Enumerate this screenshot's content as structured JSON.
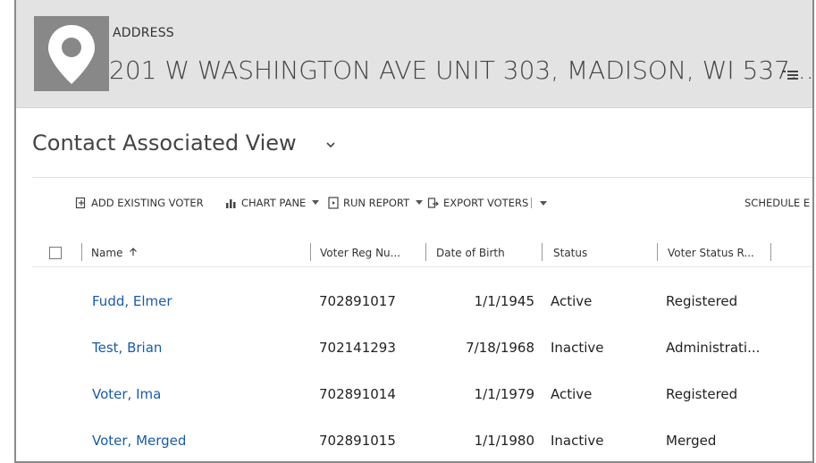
{
  "header": {
    "eyebrow": "ADDRESS",
    "title": "201 W WASHINGTON AVE UNIT 303, MADISON, WI 537...",
    "avatar_icon": "map-pin-icon",
    "menu_icon": "list-menu-icon"
  },
  "view": {
    "title": "Contact Associated View",
    "chevron_icon": "chevron-down-icon"
  },
  "commands": {
    "add_existing": "ADD EXISTING VOTER",
    "chart_pane": "CHART PANE",
    "run_report": "RUN REPORT",
    "export_voters": "EXPORT VOTERS",
    "schedule": "SCHEDULE E"
  },
  "columns": {
    "name": "Name",
    "voter_reg": "Voter Reg Nu...",
    "dob": "Date of Birth",
    "status": "Status",
    "voter_status_reason": "Voter Status R..."
  },
  "rows": [
    {
      "name": "Fudd, Elmer",
      "reg": "702891017",
      "dob": "1/1/1945",
      "status": "Active",
      "reason": "Registered"
    },
    {
      "name": "Test, Brian",
      "reg": "702141293",
      "dob": "7/18/1968",
      "status": "Inactive",
      "reason": "Administrati..."
    },
    {
      "name": "Voter, Ima",
      "reg": "702891014",
      "dob": "1/1/1979",
      "status": "Active",
      "reason": "Registered"
    },
    {
      "name": "Voter, Merged",
      "reg": "702891015",
      "dob": "1/1/1980",
      "status": "Inactive",
      "reason": "Merged"
    }
  ],
  "colors": {
    "header_bg": "#e3e3e3",
    "avatar_bg": "#888888",
    "link": "#1a5ba6"
  }
}
